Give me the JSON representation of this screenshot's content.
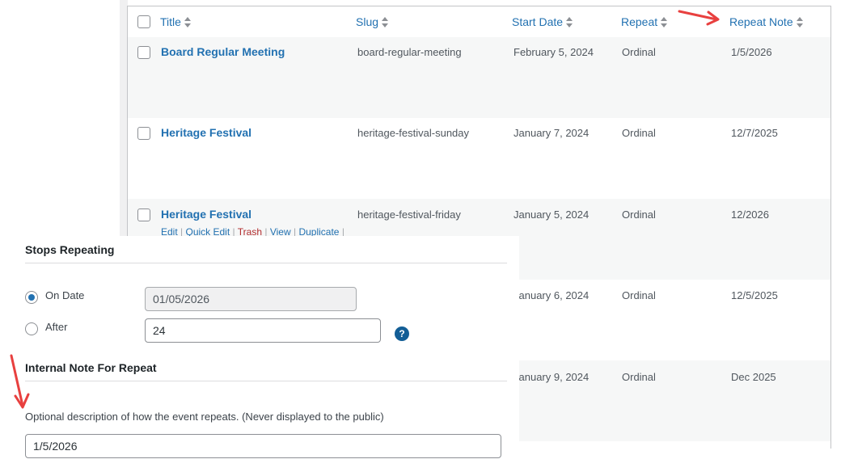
{
  "table": {
    "columns": {
      "title": "Title",
      "slug": "Slug",
      "start_date": "Start Date",
      "repeat": "Repeat",
      "repeat_note": "Repeat Note"
    },
    "rows": [
      {
        "title": "Board Regular Meeting",
        "slug": "board-regular-meeting",
        "start_date": "February 5, 2024",
        "repeat": "Ordinal",
        "repeat_note": "1/5/2026"
      },
      {
        "title": "Heritage Festival",
        "slug": "heritage-festival-sunday",
        "start_date": "January 7, 2024",
        "repeat": "Ordinal",
        "repeat_note": "12/7/2025"
      },
      {
        "title": "Heritage Festival",
        "slug": "heritage-festival-friday",
        "start_date": "January 5, 2024",
        "repeat": "Ordinal",
        "repeat_note": "12/2026"
      },
      {
        "title": "",
        "slug": "",
        "start_date": "January 6, 2024",
        "repeat": "Ordinal",
        "repeat_note": "12/5/2025"
      },
      {
        "title": "",
        "slug": "",
        "start_date": "January 9, 2024",
        "repeat": "Ordinal",
        "repeat_note": "Dec 2025"
      }
    ],
    "row_actions": {
      "edit": "Edit",
      "quick_edit": "Quick Edit",
      "trash": "Trash",
      "view": "View",
      "duplicate": "Duplicate",
      "sep": "|"
    }
  },
  "panel": {
    "stops_repeating_title": "Stops Repeating",
    "on_date_label": "On Date",
    "on_date_value": "01/05/2026",
    "after_label": "After",
    "after_value": "24",
    "help_icon": "?",
    "internal_note_title": "Internal Note For Repeat",
    "description": "Optional description of how the event repeats. (Never displayed to the public)",
    "note_value": "1/5/2026"
  },
  "colors": {
    "link": "#2271b1",
    "trash": "#b32d2e",
    "annotation_arrow": "#e8403f"
  }
}
